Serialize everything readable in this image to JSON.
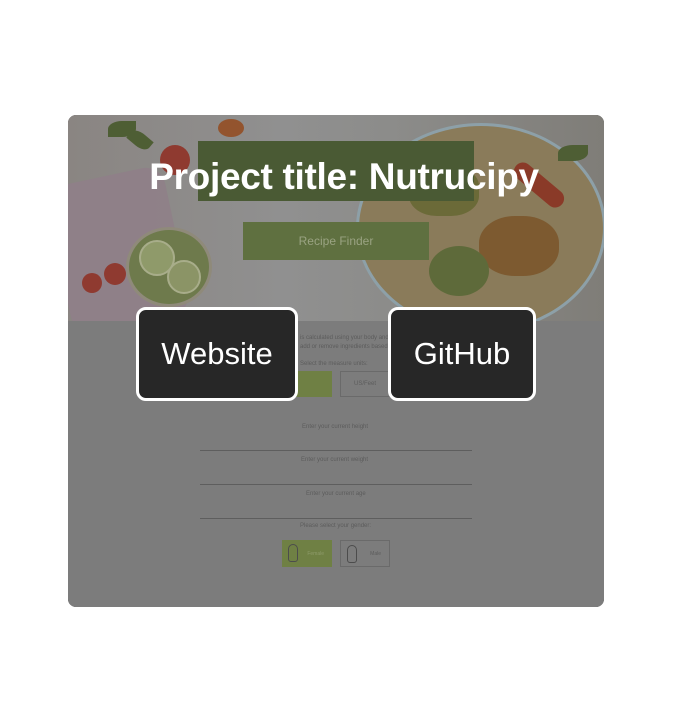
{
  "overlay": {
    "title": "Project title: Nutrucipy",
    "website_label": "Website",
    "github_label": "GitHub"
  },
  "preview": {
    "recipe_finder_label": "Recipe Finder",
    "intro_line_1": "is calculated using your body and",
    "intro_line_2": "add or remove ingredients based on yo",
    "measure_prompt": "Select the measure units:",
    "unit_metric": "",
    "unit_us": "US/Feet",
    "height_label": "Enter your current height",
    "weight_label": "Enter your current weight",
    "age_label": "Enter your current age",
    "gender_prompt": "Please select your gender:",
    "gender_female": "Female",
    "gender_male": "Male"
  },
  "colors": {
    "overlay_dim": "#7e7e7e",
    "button_bg": "#272727",
    "button_border": "#ffffff",
    "accent_green_dimmed": "#6f8044"
  }
}
